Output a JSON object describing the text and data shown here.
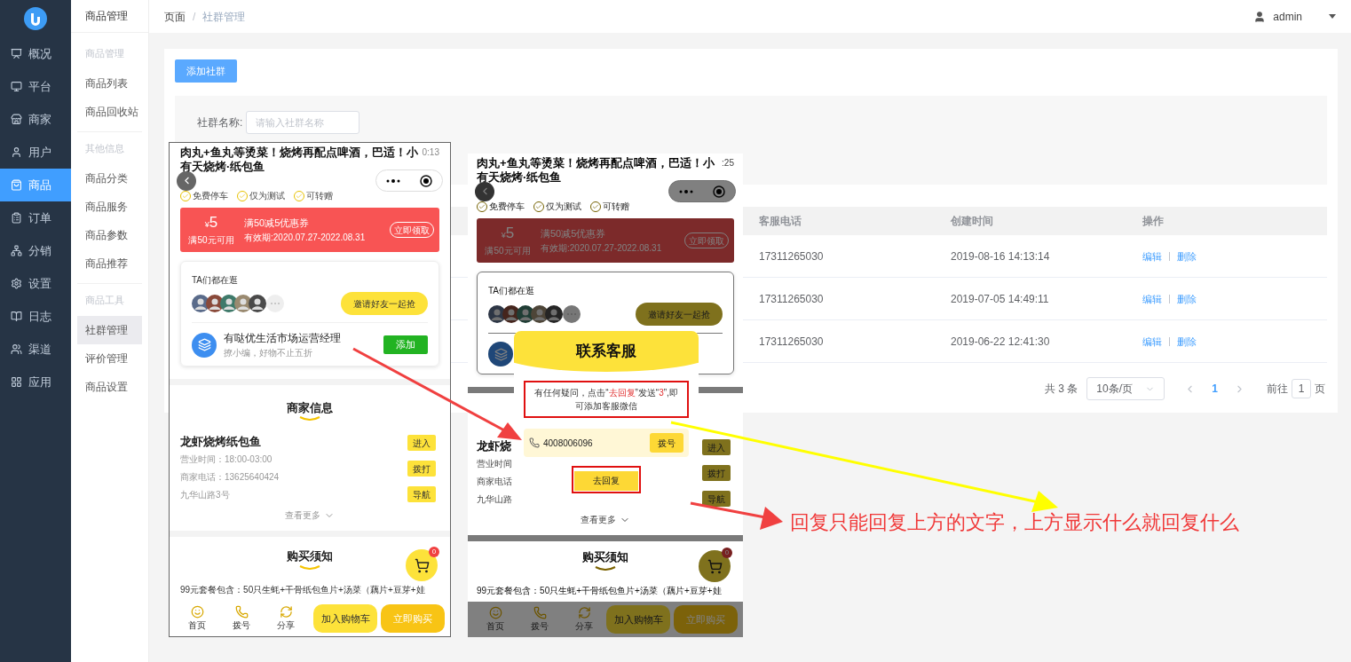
{
  "sidebar": {
    "items": [
      {
        "label": "概况",
        "selected": false
      },
      {
        "label": "平台",
        "selected": false
      },
      {
        "label": "商家",
        "selected": false
      },
      {
        "label": "用户",
        "selected": false
      },
      {
        "label": "商品",
        "selected": true
      },
      {
        "label": "订单",
        "selected": false
      },
      {
        "label": "分销",
        "selected": false
      },
      {
        "label": "设置",
        "selected": false
      },
      {
        "label": "日志",
        "selected": false
      },
      {
        "label": "渠道",
        "selected": false
      },
      {
        "label": "应用",
        "selected": false
      }
    ]
  },
  "subnav": {
    "title": "商品管理",
    "groups": [
      {
        "heading": "商品管理",
        "items": [
          {
            "label": "商品列表",
            "selected": false
          },
          {
            "label": "商品回收站",
            "selected": false
          }
        ]
      },
      {
        "heading": "其他信息",
        "items": [
          {
            "label": "商品分类",
            "selected": false
          },
          {
            "label": "商品服务",
            "selected": false
          },
          {
            "label": "商品参数",
            "selected": false
          },
          {
            "label": "商品推荐",
            "selected": false
          }
        ]
      },
      {
        "heading": "商品工具",
        "items": [
          {
            "label": "社群管理",
            "selected": true
          },
          {
            "label": "评价管理",
            "selected": false
          },
          {
            "label": "商品设置",
            "selected": false
          }
        ]
      }
    ]
  },
  "breadcrumb": [
    "页面",
    "社群管理"
  ],
  "breadcrumb_separator": "/",
  "user": "admin",
  "add_button": "添加社群",
  "filter": {
    "label": "社群名称:",
    "placeholder": "请输入社群名称"
  },
  "table": {
    "columns": [
      "客服电话",
      "创建时间",
      "操作"
    ],
    "rows": [
      {
        "phone": "17311265030",
        "created": "2019-08-16 14:13:14",
        "actions": [
          "编辑",
          "删除"
        ]
      },
      {
        "phone": "17311265030",
        "created": "2019-07-05 14:49:11",
        "actions": [
          "编辑",
          "删除"
        ]
      },
      {
        "phone": "17311265030",
        "created": "2019-06-22 12:41:30",
        "actions": [
          "编辑",
          "删除"
        ]
      }
    ]
  },
  "pagination": {
    "total": "共 3 条",
    "page_size": "10条/页",
    "pages": [
      {
        "label": "1",
        "selected": true
      }
    ],
    "goto_label": "前往",
    "goto_value": "1",
    "goto_suffix": "页"
  },
  "phones": [
    {
      "dimmed": false,
      "title": "肉丸+鱼丸等烫菜！烧烤再配点啤酒，巴适！小有天烧烤·纸包鱼",
      "time": "0:13",
      "tags": [
        "免费停车",
        "仅为测试",
        "可转赠"
      ],
      "coupon": {
        "currency": "¥",
        "amount": "5",
        "condition": "满50元可用",
        "title": "满50减5优惠券",
        "validity": "有效期:2020.07.27-2022.08.31",
        "button": "立即领取"
      },
      "browsing": {
        "heading": "TA们都在逛",
        "invite": "邀请好友一起抢"
      },
      "contact": {
        "name": "有哒优生活市场运营经理",
        "subtitle": "撩小编，好物不止五折",
        "button": "添加"
      },
      "merchant_heading": "商家信息",
      "merchant": {
        "name": "龙虾烧烤纸包鱼",
        "lines": [
          "营业时间：18:00-03:00",
          "商家电话：13625640424",
          "九华山路3号"
        ],
        "actions": [
          "进入",
          "拨打",
          "导航"
        ]
      },
      "more": "查看更多",
      "notice_heading": "购买须知",
      "notice_text": "99元套餐包含：50只生蚝+干骨纸包鱼片+汤菜（藕片+豆芽+娃",
      "cart_count": "0",
      "tabs": [
        "首页",
        "拨号",
        "分享"
      ],
      "add_cart": "加入购物车",
      "buy": "立即购买"
    },
    {
      "dimmed": true,
      "title": "肉丸+鱼丸等烫菜！烧烤再配点啤酒，巴适！小有天烧烤·纸包鱼",
      "time": ":25",
      "tags": [
        "免费停车",
        "仅为测试",
        "可转赠"
      ],
      "coupon": {
        "currency": "¥",
        "amount": "5",
        "condition": "满50元可用",
        "title": "满50减5优惠券",
        "validity": "有效期:2020.07.27-2022.08.31",
        "button": "立即领取"
      },
      "browsing": {
        "heading": "TA们都在逛",
        "invite": "邀请好友一起抢"
      },
      "merchant": {
        "name": "龙虾烧",
        "lines": [
          "营业时间",
          "商家电话",
          "九华山路"
        ],
        "actions": [
          "进入",
          "拨打",
          "导航"
        ]
      },
      "more": "查看更多",
      "notice_heading": "购买须知",
      "notice_text": "99元套餐包含：50只生蚝+干骨纸包鱼片+汤菜（藕片+豆芽+娃",
      "cart_count": "0",
      "tabs": [
        "首页",
        "拨号",
        "分享"
      ],
      "add_cart": "加入购物车",
      "buy": "立即购买",
      "modal": {
        "title": "联系客服",
        "message": [
          {
            "text": "有任何疑问，点击“",
            "highlight": false
          },
          {
            "text": "去回复",
            "highlight": true
          },
          {
            "text": "”发送“",
            "highlight": false
          },
          {
            "text": "3",
            "highlight": true
          },
          {
            "text": "”,即可添加客服微信",
            "highlight": false
          }
        ],
        "phone": "4008006096",
        "dial": "拨号",
        "reply": "去回复"
      }
    }
  ],
  "annotation": {
    "note": "回复只能回复上方的文字，上方显示什么就回复什么"
  }
}
